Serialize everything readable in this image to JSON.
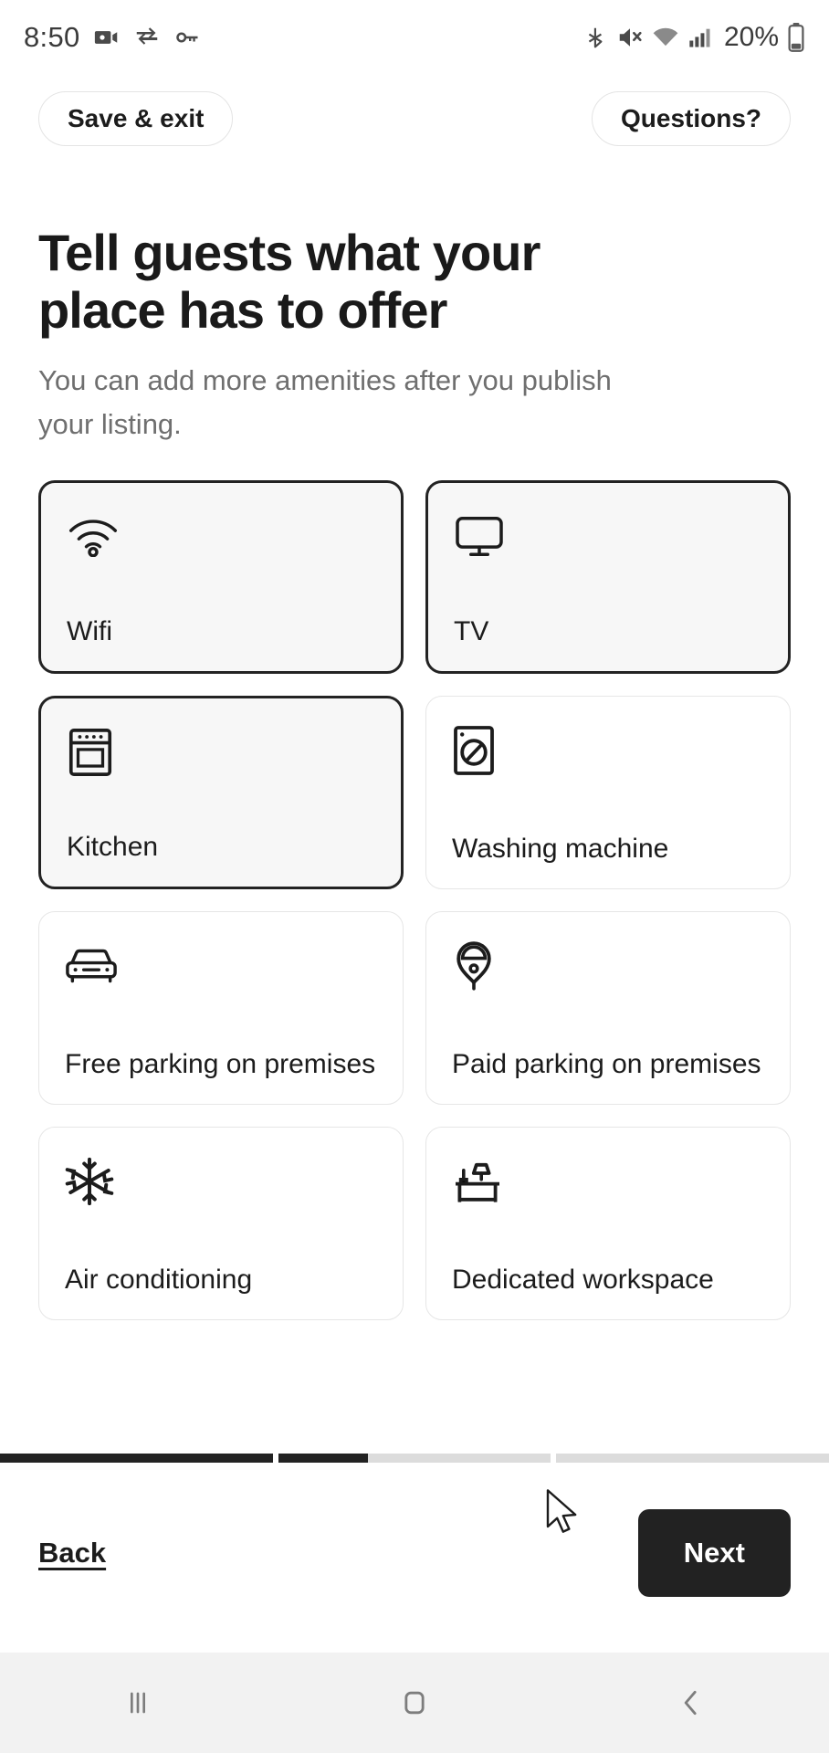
{
  "status_bar": {
    "time": "8:50",
    "battery_percent": "20%",
    "left_icons": [
      "video-camera-icon",
      "vpn-key-exchange-icon",
      "key-icon"
    ],
    "right_icons": [
      "bluetooth-icon",
      "mute-icon",
      "wifi-icon",
      "signal-icon",
      "battery-icon"
    ]
  },
  "top_nav": {
    "save_exit_label": "Save & exit",
    "questions_label": "Questions?"
  },
  "page": {
    "title": "Tell guests what your place has to offer",
    "subtitle": "You can add more amenities after you publish your listing."
  },
  "amenities": [
    {
      "label": "Wifi",
      "icon": "wifi-icon",
      "selected": true
    },
    {
      "label": "TV",
      "icon": "tv-icon",
      "selected": true
    },
    {
      "label": "Kitchen",
      "icon": "oven-icon",
      "selected": true
    },
    {
      "label": "Washing machine",
      "icon": "washing-machine-icon",
      "selected": false
    },
    {
      "label": "Free parking on premises",
      "icon": "car-icon",
      "selected": false
    },
    {
      "label": "Paid parking on premises",
      "icon": "parking-meter-icon",
      "selected": false
    },
    {
      "label": "Air conditioning",
      "icon": "snowflake-icon",
      "selected": false
    },
    {
      "label": "Dedicated workspace",
      "icon": "desk-lamp-icon",
      "selected": false
    }
  ],
  "footer": {
    "back_label": "Back",
    "next_label": "Next",
    "progress_segments": [
      100,
      33,
      0
    ]
  },
  "nav_bar": {
    "recents_icon": "recents-icon",
    "home_icon": "home-icon",
    "back_icon": "back-chevron-icon"
  },
  "colors": {
    "accent_dark": "#222222",
    "selected_fill": "#f7f7f7",
    "border_idle": "#e6e6e6",
    "muted_text": "#6f6f6f"
  }
}
